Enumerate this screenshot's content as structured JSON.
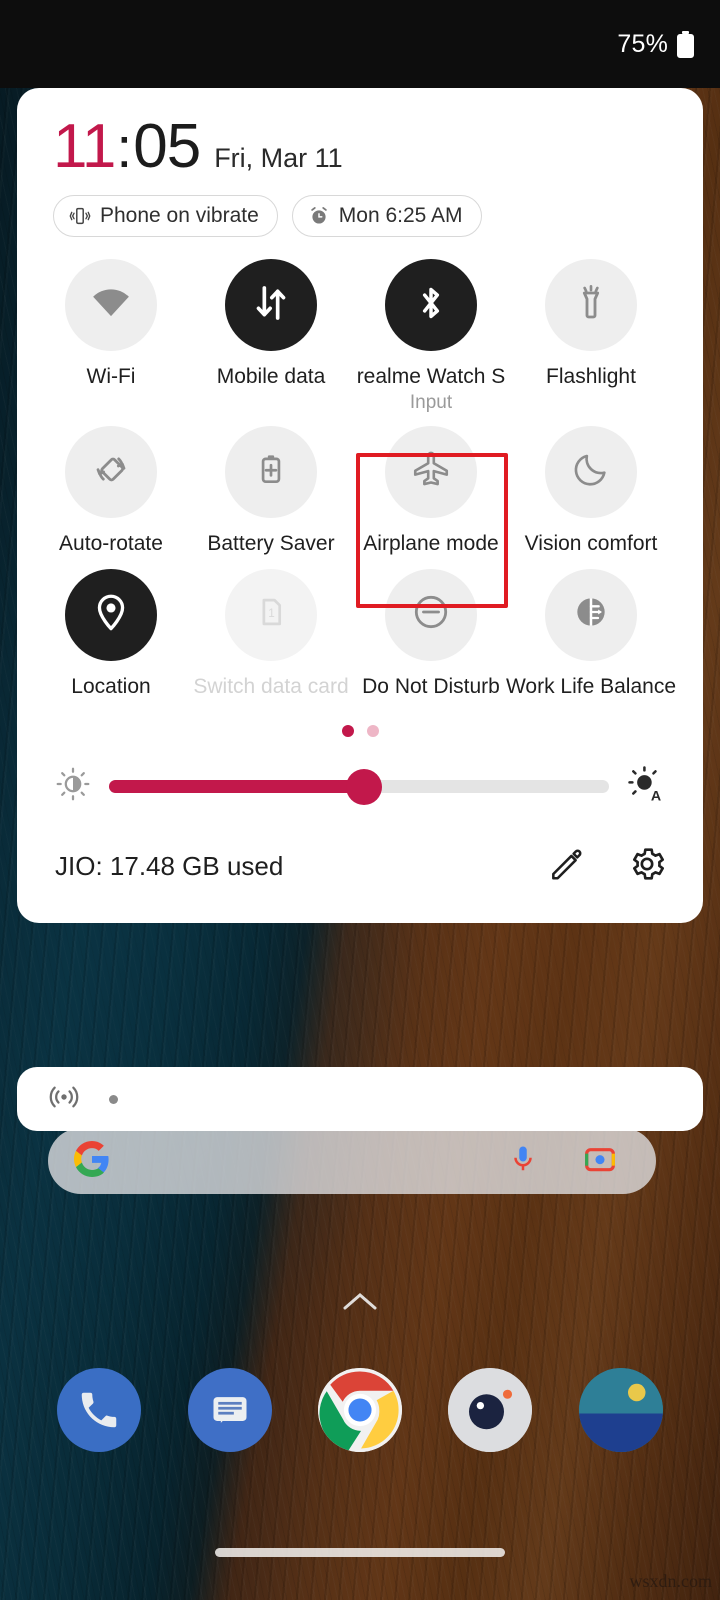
{
  "statusbar": {
    "battery_percent": "75%",
    "battery_icon": "battery-icon"
  },
  "quick_settings": {
    "clock": {
      "hour": "11",
      "colon": ":",
      "minute": "05",
      "date": "Fri, Mar 11",
      "hour_color": "#c2184b",
      "minute_color": "#1c1c1c"
    },
    "chips": [
      {
        "icon": "vibrate-icon",
        "label": "Phone on vibrate"
      },
      {
        "icon": "alarm-icon",
        "label": "Mon 6:25 AM"
      }
    ],
    "tiles": [
      {
        "label": "Wi-Fi",
        "icon": "wifi-icon",
        "state": "off"
      },
      {
        "label": "Mobile data",
        "icon": "mobile-data-icon",
        "state": "on"
      },
      {
        "label": "realme Watch S",
        "sub": "Input",
        "icon": "bluetooth-icon",
        "state": "on"
      },
      {
        "label": "Flashlight",
        "icon": "flashlight-icon",
        "state": "off"
      },
      {
        "label": "Auto-rotate",
        "icon": "auto-rotate-icon",
        "state": "off"
      },
      {
        "label": "Battery Saver",
        "icon": "battery-saver-icon",
        "state": "off"
      },
      {
        "label": "Airplane mode",
        "icon": "airplane-icon",
        "state": "off",
        "highlighted": true
      },
      {
        "label": "Vision comfort",
        "icon": "moon-icon",
        "state": "off"
      },
      {
        "label": "Location",
        "icon": "location-pin-icon",
        "state": "on"
      },
      {
        "label": "Switch data card",
        "icon": "sim-card-icon",
        "state": "disabled"
      },
      {
        "label": "Do Not Disturb",
        "icon": "do-not-disturb-icon",
        "state": "off"
      },
      {
        "label": "Work Life Balance",
        "icon": "work-life-balance-icon",
        "state": "off"
      }
    ],
    "page_dots": {
      "count": 2,
      "active_index": 0,
      "active_color": "#c2184b",
      "inactive_color": "#eeb6c6"
    },
    "brightness": {
      "value_percent": 51,
      "low_icon": "brightness-low-icon",
      "auto_icon": "brightness-auto-icon",
      "accent_color": "#c2184b"
    },
    "footer": {
      "data_usage": "JIO: 17.48 GB used",
      "edit_icon": "pencil-icon",
      "settings_icon": "gear-icon"
    },
    "highlight_color": "#e01b22"
  },
  "notification_card": {
    "icon": "cast-icon",
    "dot": "status-dot"
  },
  "home": {
    "search_bar": {
      "logo_icon": "google-g-icon",
      "mic_icon": "microphone-icon",
      "lens_icon": "google-lens-icon"
    },
    "drawer_indicator": "chevron-up-icon",
    "dock": [
      {
        "name": "phone-app",
        "icon": "phone-icon"
      },
      {
        "name": "messages-app",
        "icon": "messages-icon"
      },
      {
        "name": "chrome-app",
        "icon": "chrome-icon"
      },
      {
        "name": "camera-app",
        "icon": "camera-icon"
      },
      {
        "name": "photos-app",
        "icon": "photos-icon"
      }
    ],
    "nav_pill": "gesture-nav-pill"
  },
  "watermark": "wsxdn.com"
}
